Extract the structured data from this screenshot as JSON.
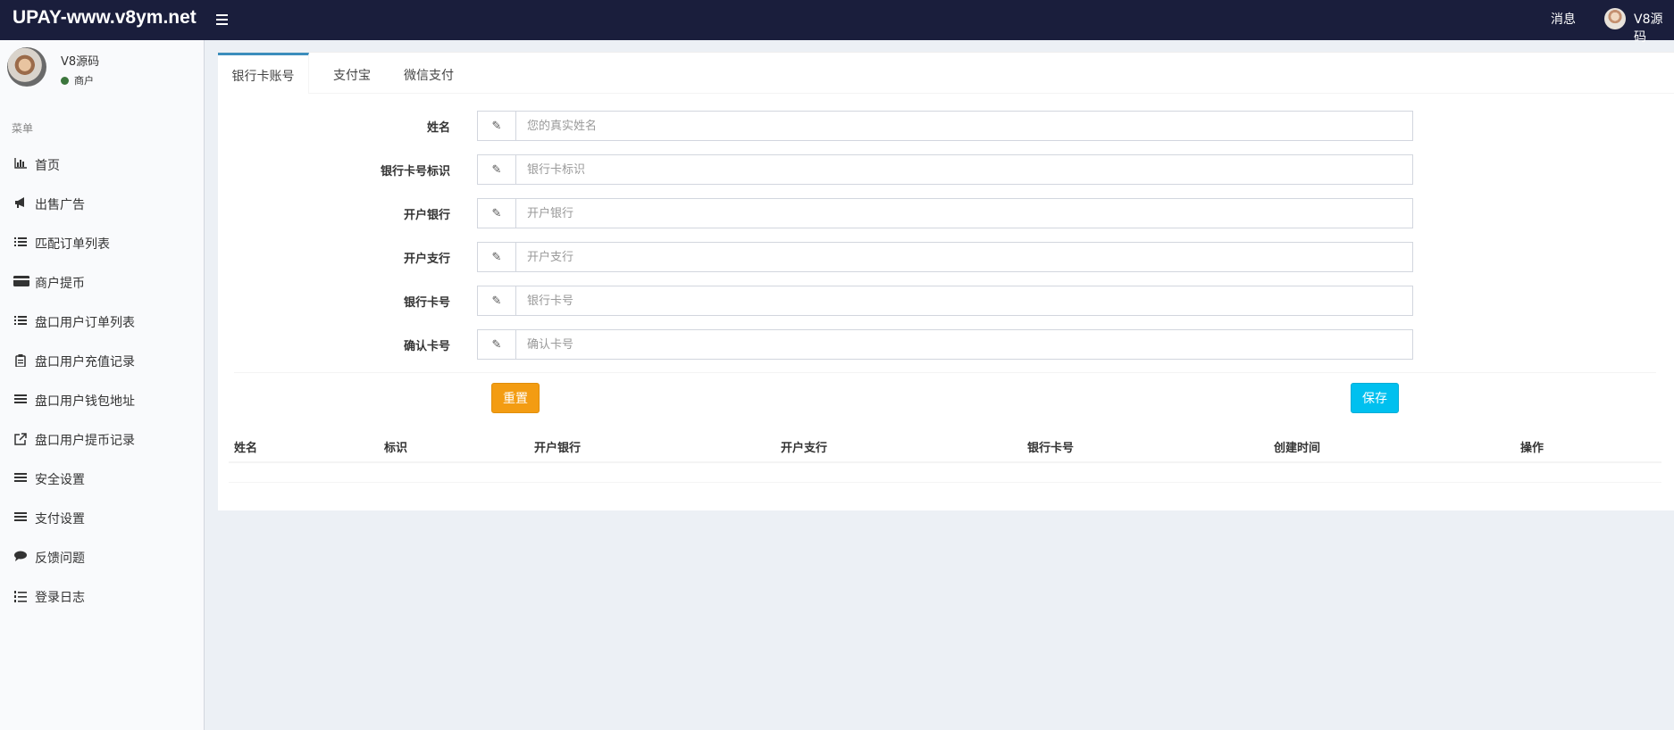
{
  "header": {
    "logo": "UPAY-www.v8ym.net",
    "messages": "消息",
    "user_name": "V8源码"
  },
  "sidebar": {
    "user_name": "V8源码",
    "status": "商户",
    "menu_header": "菜单",
    "items": [
      {
        "label": "首页",
        "icon": "bar-chart-icon"
      },
      {
        "label": "出售广告",
        "icon": "bullhorn-icon"
      },
      {
        "label": "匹配订单列表",
        "icon": "list-icon"
      },
      {
        "label": "商户提币",
        "icon": "credit-card-icon"
      },
      {
        "label": "盘口用户订单列表",
        "icon": "list-icon"
      },
      {
        "label": "盘口用户充值记录",
        "icon": "clipboard-icon"
      },
      {
        "label": "盘口用户钱包地址",
        "icon": "bars-icon"
      },
      {
        "label": "盘口用户提币记录",
        "icon": "external-link-icon"
      },
      {
        "label": "安全设置",
        "icon": "bars-icon"
      },
      {
        "label": "支付设置",
        "icon": "bars-icon"
      },
      {
        "label": "反馈问题",
        "icon": "comment-icon"
      },
      {
        "label": "登录日志",
        "icon": "list-ol-icon"
      }
    ]
  },
  "tabs": [
    "银行卡账号",
    "支付宝",
    "微信支付"
  ],
  "form": {
    "fields": [
      {
        "label": "姓名",
        "placeholder": "您的真实姓名",
        "value": ""
      },
      {
        "label": "银行卡号标识",
        "placeholder": "银行卡标识",
        "value": ""
      },
      {
        "label": "开户银行",
        "placeholder": "开户银行",
        "value": ""
      },
      {
        "label": "开户支行",
        "placeholder": "开户支行",
        "value": ""
      },
      {
        "label": "银行卡号",
        "placeholder": "银行卡号",
        "value": ""
      },
      {
        "label": "确认卡号",
        "placeholder": "确认卡号",
        "value": ""
      }
    ],
    "reset_label": "重置",
    "save_label": "保存"
  },
  "table": {
    "columns": [
      "姓名",
      "标识",
      "开户银行",
      "开户支行",
      "银行卡号",
      "创建时间",
      "操作"
    ],
    "rows": []
  },
  "colors": {
    "header_bg": "#1a1e3c",
    "tab_active": "#3c8dbc",
    "reset_button": "#f39c12",
    "save_button": "#00c0ef"
  }
}
